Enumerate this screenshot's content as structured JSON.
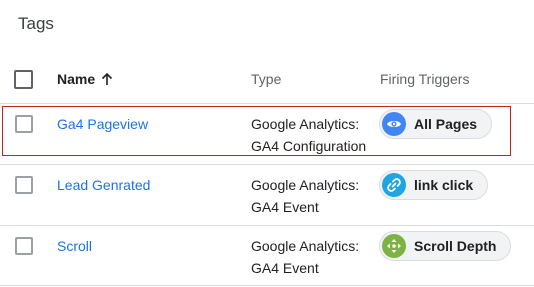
{
  "page": {
    "title": "Tags"
  },
  "table": {
    "columns": {
      "name": "Name",
      "type": "Type",
      "firing_triggers": "Firing Triggers"
    },
    "rows": [
      {
        "name": "Ga4 Pageview",
        "type_line1": "Google Analytics:",
        "type_line2": "GA4 Configuration",
        "trigger": {
          "label": "All Pages",
          "icon": "eye-icon",
          "color": "#4285f4"
        },
        "highlighted": true
      },
      {
        "name": "Lead Genrated",
        "type_line1": "Google Analytics:",
        "type_line2": "GA4 Event",
        "trigger": {
          "label": "link click",
          "icon": "link-icon",
          "color": "#1ea5e4"
        }
      },
      {
        "name": "Scroll",
        "type_line1": "Google Analytics:",
        "type_line2": "GA4 Event",
        "trigger": {
          "label": "Scroll Depth",
          "icon": "move-arrows-icon",
          "color": "#7cb342"
        }
      }
    ]
  },
  "colors": {
    "link": "#1a73e8",
    "highlight_border": "#c5221f",
    "divider": "#dadce0"
  }
}
